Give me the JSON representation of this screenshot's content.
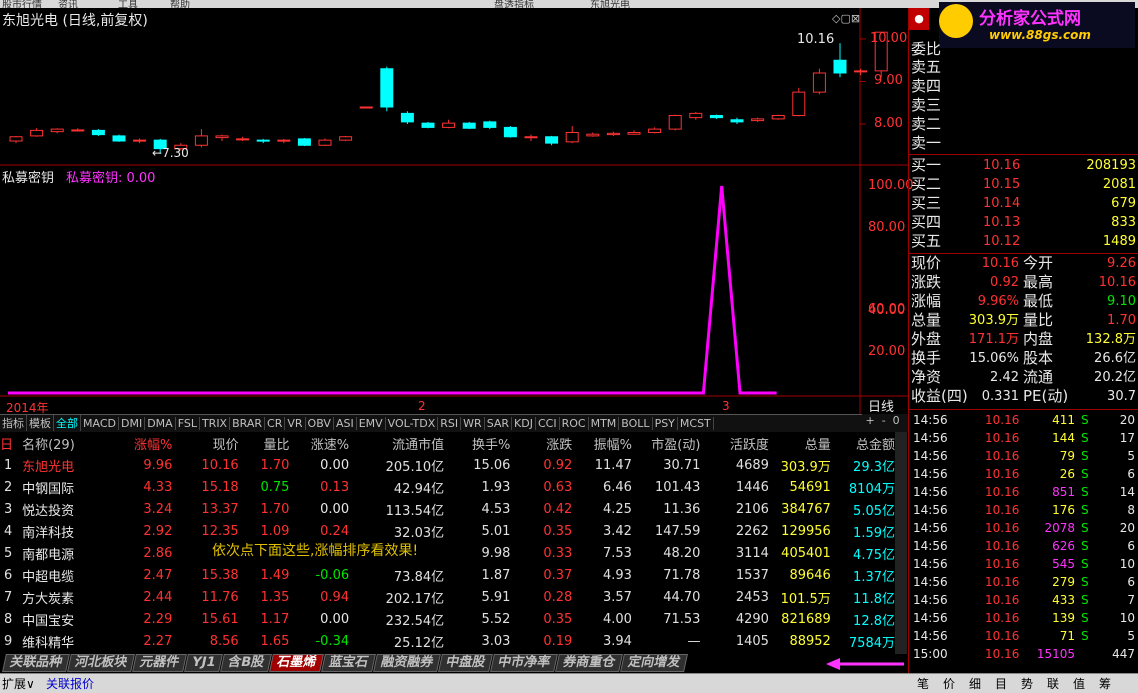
{
  "window": {
    "title_fragments": [
      "股市行情",
      "资讯",
      "工具",
      "帮助",
      "盘透指标",
      "东旭光电"
    ]
  },
  "kline": {
    "title": "东旭光电 (日线,前复权)",
    "price_labels": [
      "10.00",
      "9.00",
      "8.00"
    ],
    "high_mark": "10.16",
    "low_mark": "7.30",
    "candles": [
      {
        "o": 7.6,
        "c": 7.7,
        "h": 7.72,
        "l": 7.55
      },
      {
        "o": 7.72,
        "c": 7.85,
        "h": 7.9,
        "l": 7.7
      },
      {
        "o": 7.82,
        "c": 7.88,
        "h": 7.9,
        "l": 7.78
      },
      {
        "o": 7.86,
        "c": 7.86,
        "h": 7.9,
        "l": 7.82
      },
      {
        "o": 7.85,
        "c": 7.75,
        "h": 7.88,
        "l": 7.72
      },
      {
        "o": 7.72,
        "c": 7.6,
        "h": 7.75,
        "l": 7.58
      },
      {
        "o": 7.6,
        "c": 7.62,
        "h": 7.66,
        "l": 7.55
      },
      {
        "o": 7.62,
        "c": 7.42,
        "h": 7.65,
        "l": 7.3
      },
      {
        "o": 7.42,
        "c": 7.5,
        "h": 7.55,
        "l": 7.38
      },
      {
        "o": 7.5,
        "c": 7.72,
        "h": 7.88,
        "l": 7.45
      },
      {
        "o": 7.68,
        "c": 7.72,
        "h": 7.75,
        "l": 7.6
      },
      {
        "o": 7.65,
        "c": 7.65,
        "h": 7.7,
        "l": 7.6
      },
      {
        "o": 7.62,
        "c": 7.6,
        "h": 7.65,
        "l": 7.55
      },
      {
        "o": 7.6,
        "c": 7.62,
        "h": 7.65,
        "l": 7.55
      },
      {
        "o": 7.65,
        "c": 7.5,
        "h": 7.67,
        "l": 7.48
      },
      {
        "o": 7.5,
        "c": 7.62,
        "h": 7.66,
        "l": 7.48
      },
      {
        "o": 7.62,
        "c": 7.7,
        "h": 7.72,
        "l": 7.6
      },
      {
        "o": 8.4,
        "c": 8.4,
        "h": 8.4,
        "l": 8.4
      },
      {
        "o": 9.3,
        "c": 8.4,
        "h": 9.35,
        "l": 8.3
      },
      {
        "o": 8.25,
        "c": 8.05,
        "h": 8.3,
        "l": 8.0
      },
      {
        "o": 8.02,
        "c": 7.92,
        "h": 8.05,
        "l": 7.9
      },
      {
        "o": 7.92,
        "c": 8.02,
        "h": 8.1,
        "l": 7.9
      },
      {
        "o": 8.02,
        "c": 7.9,
        "h": 8.05,
        "l": 7.88
      },
      {
        "o": 8.05,
        "c": 7.92,
        "h": 8.08,
        "l": 7.88
      },
      {
        "o": 7.92,
        "c": 7.7,
        "h": 7.95,
        "l": 7.68
      },
      {
        "o": 7.7,
        "c": 7.7,
        "h": 7.75,
        "l": 7.6
      },
      {
        "o": 7.7,
        "c": 7.55,
        "h": 7.72,
        "l": 7.5
      },
      {
        "o": 7.58,
        "c": 7.8,
        "h": 7.95,
        "l": 7.55
      },
      {
        "o": 7.72,
        "c": 7.76,
        "h": 7.8,
        "l": 7.7
      },
      {
        "o": 7.75,
        "c": 7.78,
        "h": 7.82,
        "l": 7.72
      },
      {
        "o": 7.76,
        "c": 7.8,
        "h": 7.85,
        "l": 7.75
      },
      {
        "o": 7.8,
        "c": 7.88,
        "h": 7.92,
        "l": 7.78
      },
      {
        "o": 7.88,
        "c": 8.2,
        "h": 8.22,
        "l": 7.85
      },
      {
        "o": 8.15,
        "c": 8.25,
        "h": 8.28,
        "l": 8.1
      },
      {
        "o": 8.2,
        "c": 8.15,
        "h": 8.22,
        "l": 8.12
      },
      {
        "o": 8.1,
        "c": 8.05,
        "h": 8.15,
        "l": 8.0
      },
      {
        "o": 8.08,
        "c": 8.12,
        "h": 8.15,
        "l": 8.05
      },
      {
        "o": 8.12,
        "c": 8.2,
        "h": 8.22,
        "l": 8.1
      },
      {
        "o": 8.2,
        "c": 8.75,
        "h": 8.85,
        "l": 8.18
      },
      {
        "o": 8.75,
        "c": 9.2,
        "h": 9.3,
        "l": 8.7
      },
      {
        "o": 9.5,
        "c": 9.2,
        "h": 9.9,
        "l": 9.1
      },
      {
        "o": 9.25,
        "c": 9.25,
        "h": 9.3,
        "l": 9.15
      },
      {
        "o": 9.25,
        "c": 10.16,
        "h": 10.16,
        "l": 9.1
      }
    ]
  },
  "indicator": {
    "name": "私募密钥",
    "value_label": "私募密钥: 0.00",
    "y_labels": [
      "100.00",
      "80.00",
      "60.00",
      "40.00",
      "20.00"
    ],
    "year_label": "2014年",
    "month_marks": [
      "2",
      "3"
    ],
    "period_label": "日线",
    "series": [
      0,
      0,
      0,
      0,
      0,
      0,
      0,
      0,
      0,
      0,
      0,
      0,
      0,
      0,
      0,
      0,
      0,
      0,
      0,
      0,
      0,
      0,
      0,
      0,
      0,
      0,
      0,
      0,
      0,
      0,
      0,
      0,
      0,
      0,
      0,
      0,
      0,
      0,
      0,
      100,
      0,
      0,
      0
    ],
    "ylim": [
      0,
      100
    ]
  },
  "indicator_tabs": [
    "指标",
    "模板",
    "全部",
    "MACD",
    "DMI",
    "DMA",
    "FSL",
    "TRIX",
    "BRAR",
    "CR",
    "VR",
    "OBV",
    "ASI",
    "EMV",
    "VOL-TDX",
    "RSI",
    "WR",
    "SAR",
    "KDJ",
    "CCI",
    "ROC",
    "MTM",
    "BOLL",
    "PSY",
    "MCST"
  ],
  "list": {
    "headers": [
      "名称(29)",
      "涨幅%",
      "现价",
      "量比",
      "涨速%",
      "流通市值",
      "换手%",
      "涨跌",
      "振幅%",
      "市盈(动)",
      "活跃度",
      "总量",
      "总金额"
    ],
    "rows": [
      [
        "1",
        "东旭光电",
        "9.96",
        "10.16",
        "1.70",
        "0.00",
        "205.10亿",
        "15.06",
        "0.92",
        "11.47",
        "30.71",
        "4689",
        "303.9万",
        "29.3亿"
      ],
      [
        "2",
        "中钢国际",
        "4.33",
        "15.18",
        "0.75",
        "0.13",
        "42.94亿",
        "1.93",
        "0.63",
        "6.46",
        "101.43",
        "1446",
        "54691",
        "8104万"
      ],
      [
        "3",
        "悦达投资",
        "3.24",
        "13.37",
        "1.70",
        "0.00",
        "113.54亿",
        "4.53",
        "0.42",
        "4.25",
        "11.36",
        "2106",
        "384767",
        "5.05亿"
      ],
      [
        "4",
        "南洋科技",
        "2.92",
        "12.35",
        "1.09",
        "0.24",
        "32.03亿",
        "5.01",
        "0.35",
        "3.42",
        "147.59",
        "2262",
        "129956",
        "1.59亿"
      ],
      [
        "5",
        "南都电源",
        "2.86",
        "",
        "",
        "",
        "",
        "9.98",
        "0.33",
        "7.53",
        "48.20",
        "3114",
        "405401",
        "4.75亿"
      ],
      [
        "6",
        "中超电缆",
        "2.47",
        "15.38",
        "1.49",
        "-0.06",
        "73.84亿",
        "1.87",
        "0.37",
        "4.93",
        "71.78",
        "1537",
        "89646",
        "1.37亿"
      ],
      [
        "7",
        "方大炭素",
        "2.44",
        "11.76",
        "1.35",
        "0.94",
        "202.17亿",
        "5.91",
        "0.28",
        "3.57",
        "44.70",
        "2453",
        "101.5万",
        "11.8亿"
      ],
      [
        "8",
        "中国宝安",
        "2.29",
        "15.61",
        "1.17",
        "0.00",
        "232.54亿",
        "5.52",
        "0.35",
        "4.00",
        "71.53",
        "4290",
        "821689",
        "12.8亿"
      ],
      [
        "9",
        "维科精华",
        "2.27",
        "8.56",
        "1.65",
        "-0.34",
        "25.12亿",
        "3.03",
        "0.19",
        "3.94",
        "—",
        "1405",
        "88952",
        "7584万"
      ]
    ],
    "overlay_note": "依次点下面这些,涨幅排序看效果!"
  },
  "sheet_tabs": [
    "关联品种",
    "河北板块",
    "元器件",
    "YJ1",
    "含B股",
    "石墨烯",
    "蓝宝石",
    "融资融券",
    "中盘股",
    "中市净率",
    "券商重仓",
    "定向增发"
  ],
  "active_sheet": "石墨烯",
  "status_bar": {
    "left": [
      "扩展∨",
      "关联报价"
    ],
    "right": [
      "笔",
      "价",
      "细",
      "目",
      "势",
      "联",
      "值",
      "筹"
    ]
  },
  "orderbook": {
    "logo_text": "分析家公式网",
    "logo_url": "www.88gs.com",
    "ratio_label": "委比",
    "asks": [
      {
        "label": "卖五"
      },
      {
        "label": "卖四"
      },
      {
        "label": "卖三"
      },
      {
        "label": "卖二"
      },
      {
        "label": "卖一"
      }
    ],
    "bids": [
      {
        "label": "买一",
        "price": "10.16",
        "vol": "208193"
      },
      {
        "label": "买二",
        "price": "10.15",
        "vol": "2081"
      },
      {
        "label": "买三",
        "price": "10.14",
        "vol": "679"
      },
      {
        "label": "买四",
        "price": "10.13",
        "vol": "833"
      },
      {
        "label": "买五",
        "price": "10.12",
        "vol": "1489"
      }
    ],
    "stats": [
      [
        "现价",
        "10.16",
        "今开",
        "9.26"
      ],
      [
        "涨跌",
        "0.92",
        "最高",
        "10.16"
      ],
      [
        "涨幅",
        "9.96%",
        "最低",
        "9.10"
      ],
      [
        "总量",
        "303.9万",
        "量比",
        "1.70"
      ],
      [
        "外盘",
        "171.1万",
        "内盘",
        "132.8万"
      ],
      [
        "换手",
        "15.06%",
        "股本",
        "26.6亿"
      ],
      [
        "净资",
        "2.42",
        "流通",
        "20.2亿"
      ],
      [
        "收益(四)",
        "0.331",
        "PE(动)",
        "30.7"
      ]
    ],
    "trades": [
      [
        "14:56",
        "10.16",
        "411",
        "S",
        "20"
      ],
      [
        "14:56",
        "10.16",
        "144",
        "S",
        "17"
      ],
      [
        "14:56",
        "10.16",
        "79",
        "S",
        "5"
      ],
      [
        "14:56",
        "10.16",
        "26",
        "S",
        "6"
      ],
      [
        "14:56",
        "10.16",
        "851",
        "S",
        "14"
      ],
      [
        "14:56",
        "10.16",
        "176",
        "S",
        "8"
      ],
      [
        "14:56",
        "10.16",
        "2078",
        "S",
        "20"
      ],
      [
        "14:56",
        "10.16",
        "626",
        "S",
        "6"
      ],
      [
        "14:56",
        "10.16",
        "545",
        "S",
        "10"
      ],
      [
        "14:56",
        "10.16",
        "279",
        "S",
        "6"
      ],
      [
        "14:56",
        "10.16",
        "433",
        "S",
        "7"
      ],
      [
        "14:56",
        "10.16",
        "139",
        "S",
        "10"
      ],
      [
        "14:56",
        "10.16",
        "71",
        "S",
        "5"
      ],
      [
        "15:00",
        "10.16",
        "15105",
        "",
        "447"
      ]
    ]
  }
}
